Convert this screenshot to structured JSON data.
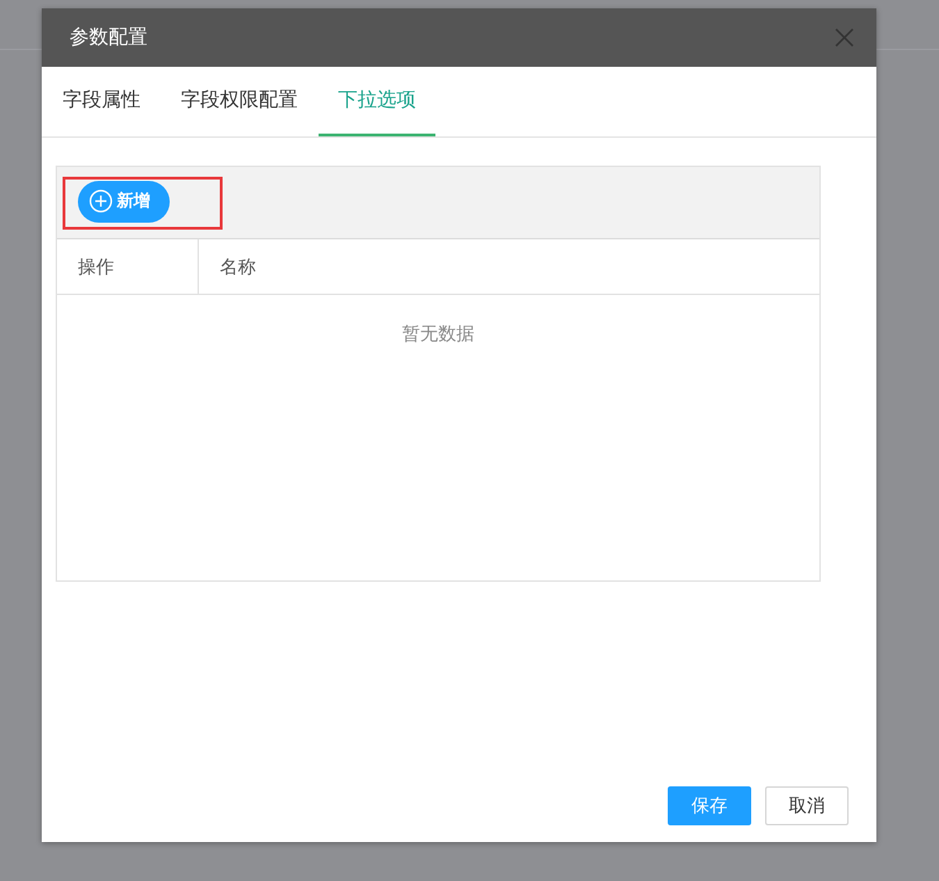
{
  "dialog": {
    "title": "参数配置"
  },
  "tabs": [
    {
      "label": "字段属性",
      "selected": false
    },
    {
      "label": "字段权限配置",
      "selected": false
    },
    {
      "label": "下拉选项",
      "selected": true
    }
  ],
  "toolbar": {
    "add_button": {
      "label": "新增",
      "highlighted": true
    }
  },
  "table": {
    "columns": [
      "操作",
      "名称"
    ],
    "empty_text": "暂无数据"
  },
  "buttons": [
    {
      "label": "保存",
      "kind": "primary"
    },
    {
      "label": "取消",
      "kind": "default"
    }
  ]
}
